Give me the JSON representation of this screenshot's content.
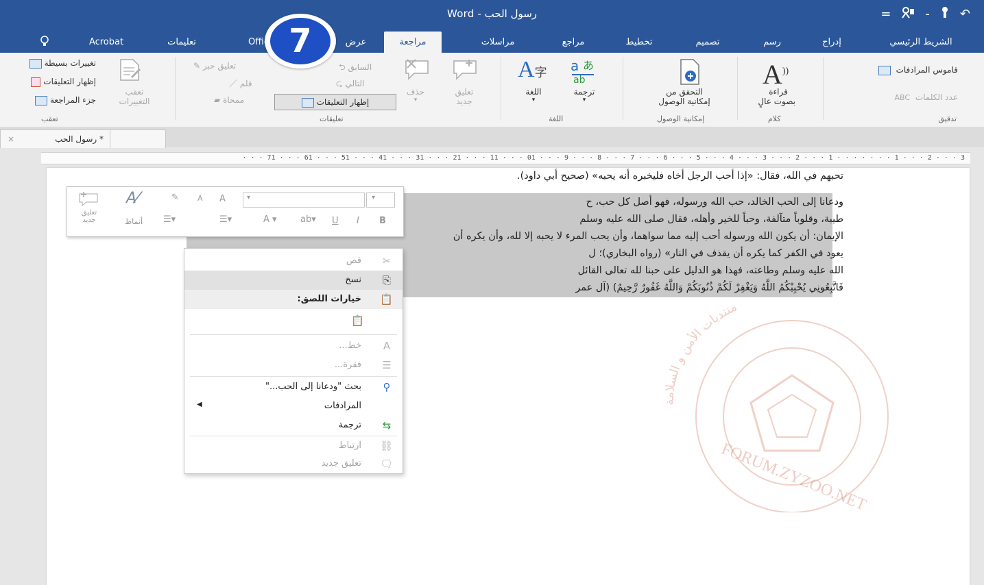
{
  "window": {
    "title": "رسول الحب - Word"
  },
  "quick_access": {
    "undo": "↶",
    "redo": "↷",
    "save_sep": "-",
    "customize": "="
  },
  "tabs": [
    {
      "label": "الشريط الرئيسي"
    },
    {
      "label": "إدراج"
    },
    {
      "label": "رسم"
    },
    {
      "label": "تصميم"
    },
    {
      "label": "تخطيط"
    },
    {
      "label": "مراجع"
    },
    {
      "label": "مراسلات"
    },
    {
      "label": "مراجعة",
      "active": true
    },
    {
      "label": "عرض"
    },
    {
      "label": "Office"
    },
    {
      "label": "تعليمات"
    },
    {
      "label": "Acrobat"
    },
    {
      "label": "أخبرني"
    }
  ],
  "ribbon": {
    "proofing": {
      "group_label": "تدقيق",
      "thesaurus": "قاموس المرادفات",
      "word_count": "عدد الكلمات"
    },
    "speech": {
      "group_label": "كلام",
      "read_aloud_1": "قراءة",
      "read_aloud_2": "بصوت عالٍ"
    },
    "accessibility": {
      "group_label": "إمكانية الوصول",
      "check_1": "التحقق من",
      "check_2": "إمكانية الوصول"
    },
    "language": {
      "group_label": "اللغة",
      "translate": "ترجمة",
      "language": "اللغة"
    },
    "comments": {
      "group_label": "تعليقات",
      "new_comment_1": "تعليق",
      "new_comment_2": "جديد",
      "delete": "حذف",
      "previous": "السابق",
      "next": "التالي",
      "show_comments": "إظهار التعليقات",
      "ink_comment": "تعليق حبر",
      "pen": "قلم",
      "eraser": "ممحاة"
    },
    "tracking": {
      "group_label": "تعقب",
      "track_changes_1": "تعقب",
      "track_changes_2": "التغييرات",
      "simple_markup": "تغييرات بسيطة",
      "show_markup": "إظهار التعليقات",
      "reviewing_pane": "جزء المراجعة"
    }
  },
  "document_tab": {
    "title": "* رسول الحب",
    "close": "×"
  },
  "ruler": {
    "ticks": "· · · 71 · · · 61 · · · 51 · · · 41 · · · 31 · · · 21 · · · 11 · · · 01 · · · 9 · · · 8 · · · 7 · · · 6 · · · 5 · · · 4 · · · 3 · · · 2 · · · 1 · · · · · · · 1 · · · 2 · · · 3"
  },
  "document": {
    "line1": "تحبهم في الله، فقال: «إذا أحب الرجل أخاه فليخبره أنه يحبه» (صحيح أبي داود).",
    "line2": "ودعانا إلى الحب الخالد، حب الله ورسوله، فهو أصل كل حب، ح",
    "line3": "طيبة، وقلوباً متآلفة، وحباً للخير وأهله، فقال صلى الله عليه وسلم",
    "line4": "الإيمان: أن يكون الله ورسوله أحب إليه مما سواهما، وأن يحب المرء لا يحبه إلا لله، وأن يكره أن",
    "line5": "يعود في الكفر كما يكره أن يقذف في النار» (رواه البخاري)؛ ل",
    "line6": "الله عليه وسلم وطاعته، فهذا هو الدليل على حبنا لله تعالى القائل",
    "line7": "فَاتَّبِعُونِي يُحْبِبْكُمُ اللَّهُ وَيَغْفِرْ لَكُمْ ذُنُوبَكُمْ وَاللَّهُ غَفُورٌ رَّحِيمٌ) (آل عمر"
  },
  "watermark": {
    "text_arc": "منتديات الأمن و السلامة",
    "text_bottom": "FORUM.ZYZOO.NET"
  },
  "mini_toolbar": {
    "bold": "B",
    "italic": "I",
    "underline": "U",
    "font_color": "A",
    "styles": "أنماط",
    "new_comment_1": "تعليق",
    "new_comment_2": "جديد",
    "grow": "A",
    "shrink": "A"
  },
  "context_menu": {
    "cut": "قص",
    "copy": "نسخ",
    "paste_options": "خيارات اللصق:",
    "font": "خط...",
    "paragraph": "فقرة...",
    "search": "بحث \"ودعانا إلى الحب...\"",
    "synonyms": "المرادفات",
    "translate": "ترجمة",
    "link": "ارتباط",
    "new_comment": "تعليق جديد"
  },
  "step_badge": {
    "number": "7"
  },
  "colors": {
    "word_blue": "#2b579a",
    "badge_blue": "#1f4fc4",
    "watermark": "#c8593a"
  }
}
